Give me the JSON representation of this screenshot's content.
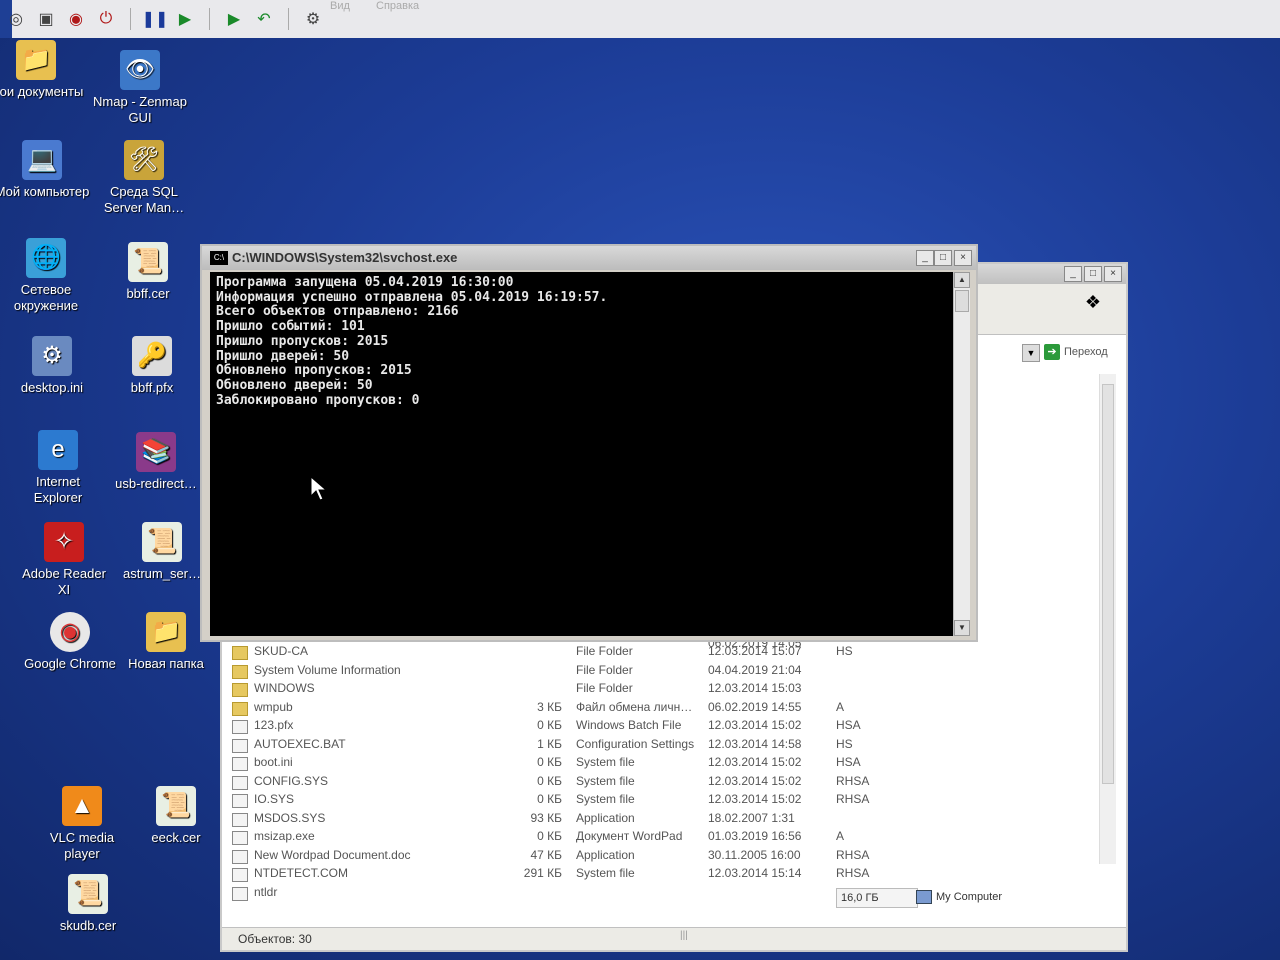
{
  "vm_toolbar": {
    "menu_faint": [
      "Вид",
      "Справка"
    ],
    "buttons": [
      {
        "icon": "record-icon"
      },
      {
        "icon": "stop-icon"
      },
      {
        "icon": "reset-icon"
      },
      {
        "icon": "power-icon"
      },
      {
        "icon": "pause-icon"
      },
      {
        "icon": "play-icon"
      },
      {
        "icon": "snapshot-icon"
      },
      {
        "icon": "revert-icon"
      },
      {
        "icon": "settings-icon"
      }
    ]
  },
  "desktop": {
    "icons": [
      {
        "label": "Мои документы",
        "icon": "my-documents-icon"
      },
      {
        "label": "Nmap - Zenmap GUI",
        "icon": "nmap-icon"
      },
      {
        "label": "Мой компьютер",
        "icon": "my-computer-icon"
      },
      {
        "label": "Среда SQL Server Man…",
        "icon": "sql-server-icon"
      },
      {
        "label": "Сетевое окружение",
        "icon": "network-icon"
      },
      {
        "label": "bbff.cer",
        "icon": "certificate-icon"
      },
      {
        "label": "desktop.ini",
        "icon": "ini-file-icon"
      },
      {
        "label": "bbff.pfx",
        "icon": "pfx-file-icon"
      },
      {
        "label": "Internet Explorer",
        "icon": "internet-explorer-icon"
      },
      {
        "label": "usb-redirect…",
        "icon": "winrar-icon"
      },
      {
        "label": "Adobe Reader XI",
        "icon": "adobe-reader-icon"
      },
      {
        "label": "astrum_ser…",
        "icon": "certificate-icon"
      },
      {
        "label": "Google Chrome",
        "icon": "chrome-icon"
      },
      {
        "label": "Новая папка",
        "icon": "folder-icon"
      },
      {
        "label": "VLC media player",
        "icon": "vlc-icon"
      },
      {
        "label": "eeck.cer",
        "icon": "certificate-icon"
      },
      {
        "label": "skudb.cer",
        "icon": "certificate-icon"
      }
    ]
  },
  "console": {
    "title": "C:\\WINDOWS\\System32\\svchost.exe",
    "lines": [
      "Программа запущена 05.04.2019 16:30:00",
      "Информация успешно отправлена 05.04.2019 16:19:57.",
      "Всего объектов отправлено: 2166",
      "Пришло событий: 101",
      "Пришло пропусков: 2015",
      "Пришло дверей: 50",
      "Обновлено пропусков: 2015",
      "Обновлено дверей: 50",
      "Заблокировано пропусков: 0"
    ]
  },
  "explorer": {
    "go_label": "Переход",
    "files": [
      {
        "name": "SKUD-CA",
        "size": "",
        "type": "File Folder",
        "date": "12.03.2014 15:07",
        "attr": "HS",
        "icon": "folder-icon"
      },
      {
        "name": "System Volume Information",
        "size": "",
        "type": "File Folder",
        "date": "04.04.2019 21:04",
        "attr": "",
        "icon": "folder-icon"
      },
      {
        "name": "WINDOWS",
        "size": "",
        "type": "File Folder",
        "date": "12.03.2014 15:03",
        "attr": "",
        "icon": "folder-icon"
      },
      {
        "name": "wmpub",
        "size": "3 КБ",
        "type": "Файл обмена личн…",
        "date": "06.02.2019 14:55",
        "attr": "A",
        "icon": "folder-icon"
      },
      {
        "name": "123.pfx",
        "size": "0 КБ",
        "type": "Windows Batch File",
        "date": "12.03.2014 15:02",
        "attr": "HSA",
        "icon": "file-icon"
      },
      {
        "name": "AUTOEXEC.BAT",
        "size": "1 КБ",
        "type": "Configuration Settings",
        "date": "12.03.2014 14:58",
        "attr": "HS",
        "icon": "file-icon"
      },
      {
        "name": "boot.ini",
        "size": "0 КБ",
        "type": "System file",
        "date": "12.03.2014 15:02",
        "attr": "HSA",
        "icon": "file-icon"
      },
      {
        "name": "CONFIG.SYS",
        "size": "0 КБ",
        "type": "System file",
        "date": "12.03.2014 15:02",
        "attr": "RHSA",
        "icon": "file-icon"
      },
      {
        "name": "IO.SYS",
        "size": "0 КБ",
        "type": "System file",
        "date": "12.03.2014 15:02",
        "attr": "RHSA",
        "icon": "file-icon"
      },
      {
        "name": "MSDOS.SYS",
        "size": "93 КБ",
        "type": "Application",
        "date": "18.02.2007 1:31",
        "attr": "",
        "icon": "file-icon"
      },
      {
        "name": "msizap.exe",
        "size": "0 КБ",
        "type": "Документ WordPad",
        "date": "01.03.2019 16:56",
        "attr": "A",
        "icon": "file-icon"
      },
      {
        "name": "New Wordpad Document.doc",
        "size": "47 КБ",
        "type": "Application",
        "date": "30.11.2005 16:00",
        "attr": "RHSA",
        "icon": "file-icon"
      },
      {
        "name": "NTDETECT.COM",
        "size": "291 КБ",
        "type": "System file",
        "date": "12.03.2014 15:14",
        "attr": "RHSA",
        "icon": "file-icon"
      },
      {
        "name": "ntldr",
        "size": "",
        "type": "",
        "date": "",
        "attr": "",
        "icon": "file-icon"
      }
    ],
    "partial_row_date": "06.02.2019 14:05",
    "status": {
      "count": "Объектов: 30",
      "size": "16,0 ГБ",
      "zone": "My Computer"
    }
  }
}
